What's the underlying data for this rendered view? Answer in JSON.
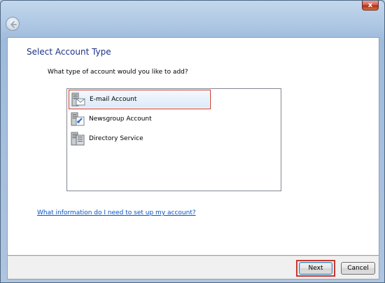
{
  "window": {
    "close_glyph": "x",
    "back_icon": "back-arrow-icon"
  },
  "page": {
    "title": "Select Account Type",
    "question": "What type of account would you like to add?"
  },
  "account_types": [
    {
      "label": "E-mail Account",
      "icon": "email-server-icon",
      "selected": true
    },
    {
      "label": "Newsgroup Account",
      "icon": "newsgroup-server-icon",
      "selected": false
    },
    {
      "label": "Directory Service",
      "icon": "directory-server-icon",
      "selected": false
    }
  ],
  "help_link": "What information do I need to set up my account?",
  "footer": {
    "next_label": "Next",
    "cancel_label": "Cancel"
  },
  "colors": {
    "title": "#1e3287",
    "link": "#0056c8",
    "highlight": "#c8382e"
  }
}
